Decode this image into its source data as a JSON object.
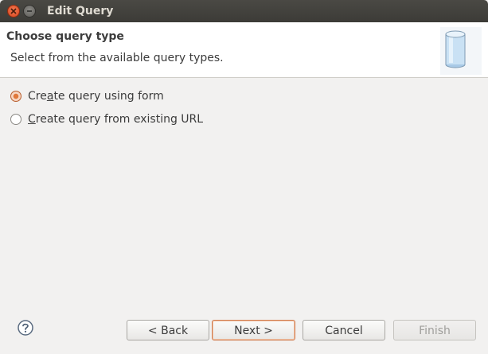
{
  "window": {
    "title": "Edit Query",
    "close_icon": "close-icon",
    "minimize_icon": "minimize-icon"
  },
  "header": {
    "title": "Choose query type",
    "description": "Select from the available query types.",
    "icon": "database-icon"
  },
  "options": [
    {
      "label_pre": "Cre",
      "label_mnemonic": "a",
      "label_post": "te query using form",
      "checked": true
    },
    {
      "label_pre": "",
      "label_mnemonic": "C",
      "label_post": "reate query from existing URL",
      "checked": false
    }
  ],
  "footer": {
    "help_icon": "help-icon",
    "back_label": "< Back",
    "next_label": "Next >",
    "cancel_label": "Cancel",
    "finish_label": "Finish"
  },
  "colors": {
    "accent": "#e0783b",
    "titlebar": "#3c3b37",
    "window_bg": "#f2f1f0"
  }
}
